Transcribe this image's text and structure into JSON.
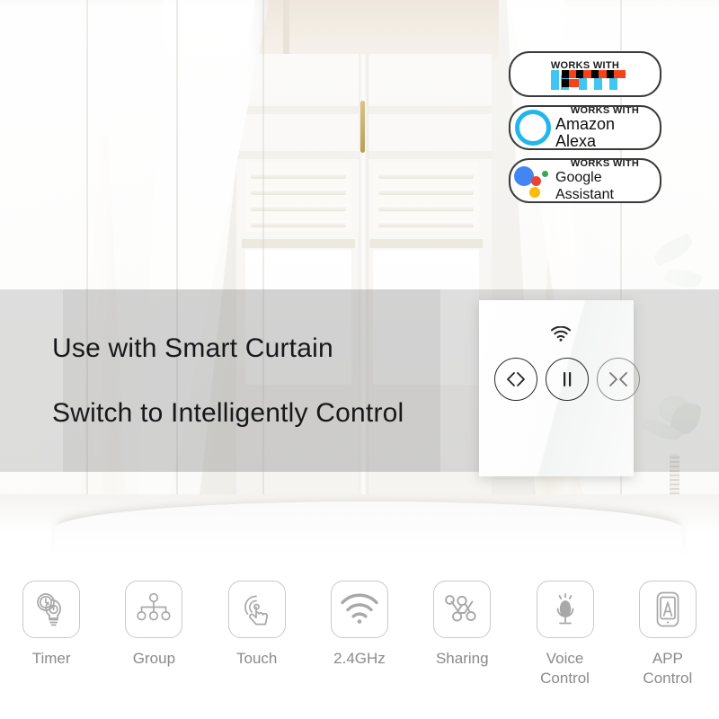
{
  "headline": {
    "line1": "Use with Smart Curtain",
    "line2": "Switch to Intelligently Control"
  },
  "badges": [
    {
      "id": "ifttt",
      "works_with": "WORKS WITH",
      "brand": "IFTTT",
      "logo": "ifttt-logo"
    },
    {
      "id": "alexa",
      "works_with": "WORKS WITH",
      "brand": "Amazon Alexa",
      "logo": "alexa-logo"
    },
    {
      "id": "google",
      "works_with": "WORKS WITH",
      "brand": "Google Assistant",
      "logo": "google-assistant-logo"
    }
  ],
  "switch_panel": {
    "wifi_indicator": "wifi-icon",
    "buttons": [
      {
        "name": "open",
        "glyph": "open-arrows-icon"
      },
      {
        "name": "pause",
        "glyph": "pause-icon"
      },
      {
        "name": "close",
        "glyph": "close-arrows-icon"
      }
    ]
  },
  "features": [
    {
      "label": "Timer",
      "icon": "timer-bulb-icon"
    },
    {
      "label": "Group",
      "icon": "group-tree-icon"
    },
    {
      "label": "Touch",
      "icon": "touch-finger-icon"
    },
    {
      "label": "2.4GHz",
      "icon": "wifi-icon"
    },
    {
      "label": "Sharing",
      "icon": "sharing-nodes-icon"
    },
    {
      "label": "Voice\nControl",
      "icon": "microphone-icon"
    },
    {
      "label": "APP\nControl",
      "icon": "app-phone-icon"
    }
  ],
  "colors": {
    "ifttt_blue": "#3fc6f2",
    "ifttt_orange": "#f4431c",
    "alexa_cyan": "#22b7ea",
    "google_blue": "#4285f4",
    "google_red": "#ea4335",
    "google_yellow": "#fbbc05",
    "google_green": "#34a853",
    "feature_gray": "#8a8a8a",
    "headline_text": "#17181a"
  }
}
